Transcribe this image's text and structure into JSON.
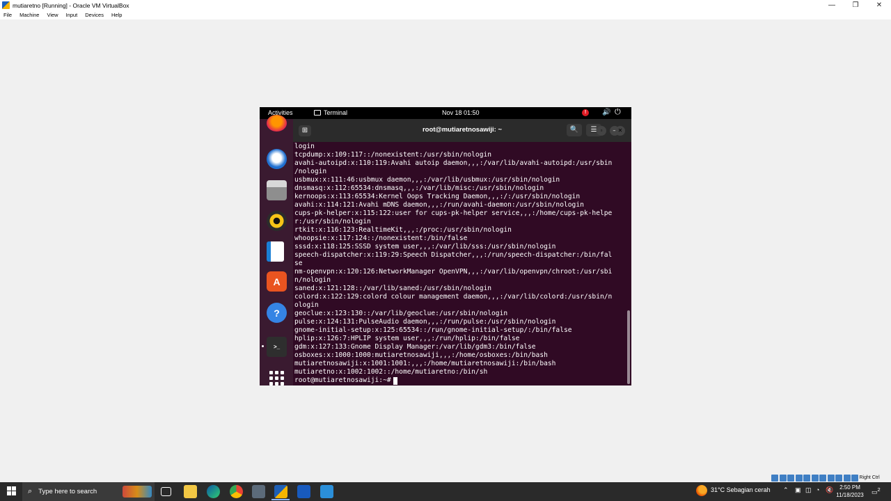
{
  "host_window": {
    "title": "mutiaretno [Running] - Oracle VM VirtualBox",
    "minimize": "—",
    "restore": "❐",
    "close": "✕",
    "menu": [
      "File",
      "Machine",
      "View",
      "Input",
      "Devices",
      "Help"
    ]
  },
  "guest_topbar": {
    "activities": "Activities",
    "app_name": "Terminal",
    "datetime": "Nov 18  01:50",
    "alert": "!",
    "volume_icon": "🔊",
    "power_icon": "⏻"
  },
  "terminal": {
    "title": "root@mutiaretnosawiji: ~",
    "newtab_icon": "⊞",
    "search_icon": "🔍",
    "menu_icon": "☰",
    "minimize": "–",
    "maximize": "▫",
    "close": "✕",
    "output": [
      "login",
      "tcpdump:x:109:117::/nonexistent:/usr/sbin/nologin",
      "avahi-autoipd:x:110:119:Avahi autoip daemon,,,:/var/lib/avahi-autoipd:/usr/sbin",
      "/nologin",
      "usbmux:x:111:46:usbmux daemon,,,:/var/lib/usbmux:/usr/sbin/nologin",
      "dnsmasq:x:112:65534:dnsmasq,,,:/var/lib/misc:/usr/sbin/nologin",
      "kernoops:x:113:65534:Kernel Oops Tracking Daemon,,,:/:/usr/sbin/nologin",
      "avahi:x:114:121:Avahi mDNS daemon,,,:/run/avahi-daemon:/usr/sbin/nologin",
      "cups-pk-helper:x:115:122:user for cups-pk-helper service,,,:/home/cups-pk-helpe",
      "r:/usr/sbin/nologin",
      "rtkit:x:116:123:RealtimeKit,,,:/proc:/usr/sbin/nologin",
      "whoopsie:x:117:124::/nonexistent:/bin/false",
      "sssd:x:118:125:SSSD system user,,,:/var/lib/sss:/usr/sbin/nologin",
      "speech-dispatcher:x:119:29:Speech Dispatcher,,,:/run/speech-dispatcher:/bin/fal",
      "se",
      "nm-openvpn:x:120:126:NetworkManager OpenVPN,,,:/var/lib/openvpn/chroot:/usr/sbi",
      "n/nologin",
      "saned:x:121:128::/var/lib/saned:/usr/sbin/nologin",
      "colord:x:122:129:colord colour management daemon,,,:/var/lib/colord:/usr/sbin/n",
      "ologin",
      "geoclue:x:123:130::/var/lib/geoclue:/usr/sbin/nologin",
      "pulse:x:124:131:PulseAudio daemon,,,:/run/pulse:/usr/sbin/nologin",
      "gnome-initial-setup:x:125:65534::/run/gnome-initial-setup/:/bin/false",
      "hplip:x:126:7:HPLIP system user,,,:/run/hplip:/bin/false",
      "gdm:x:127:133:Gnome Display Manager:/var/lib/gdm3:/bin/false",
      "osboxes:x:1000:1000:mutiaretnosawiji,,,:/home/osboxes:/bin/bash",
      "mutiaretnosawiji:x:1001:1001:,,,:/home/mutiaretnosawiji:/bin/bash",
      "mutiaretno:x:1002:1002::/home/mutiaretno:/bin/sh"
    ],
    "prompt": "root@mutiaretnosawiji:~#"
  },
  "dock": {
    "software_glyph": "A",
    "help_glyph": "?",
    "terminal_glyph": ">_"
  },
  "vbox_status": {
    "host_key": "Right Ctrl"
  },
  "taskbar": {
    "search_placeholder": "Type here to search",
    "search_glyph": "⌕",
    "weather": "31°C  Sebagian cerah",
    "time": "2:50 PM",
    "date": "11/18/2023",
    "notifications": "2"
  }
}
